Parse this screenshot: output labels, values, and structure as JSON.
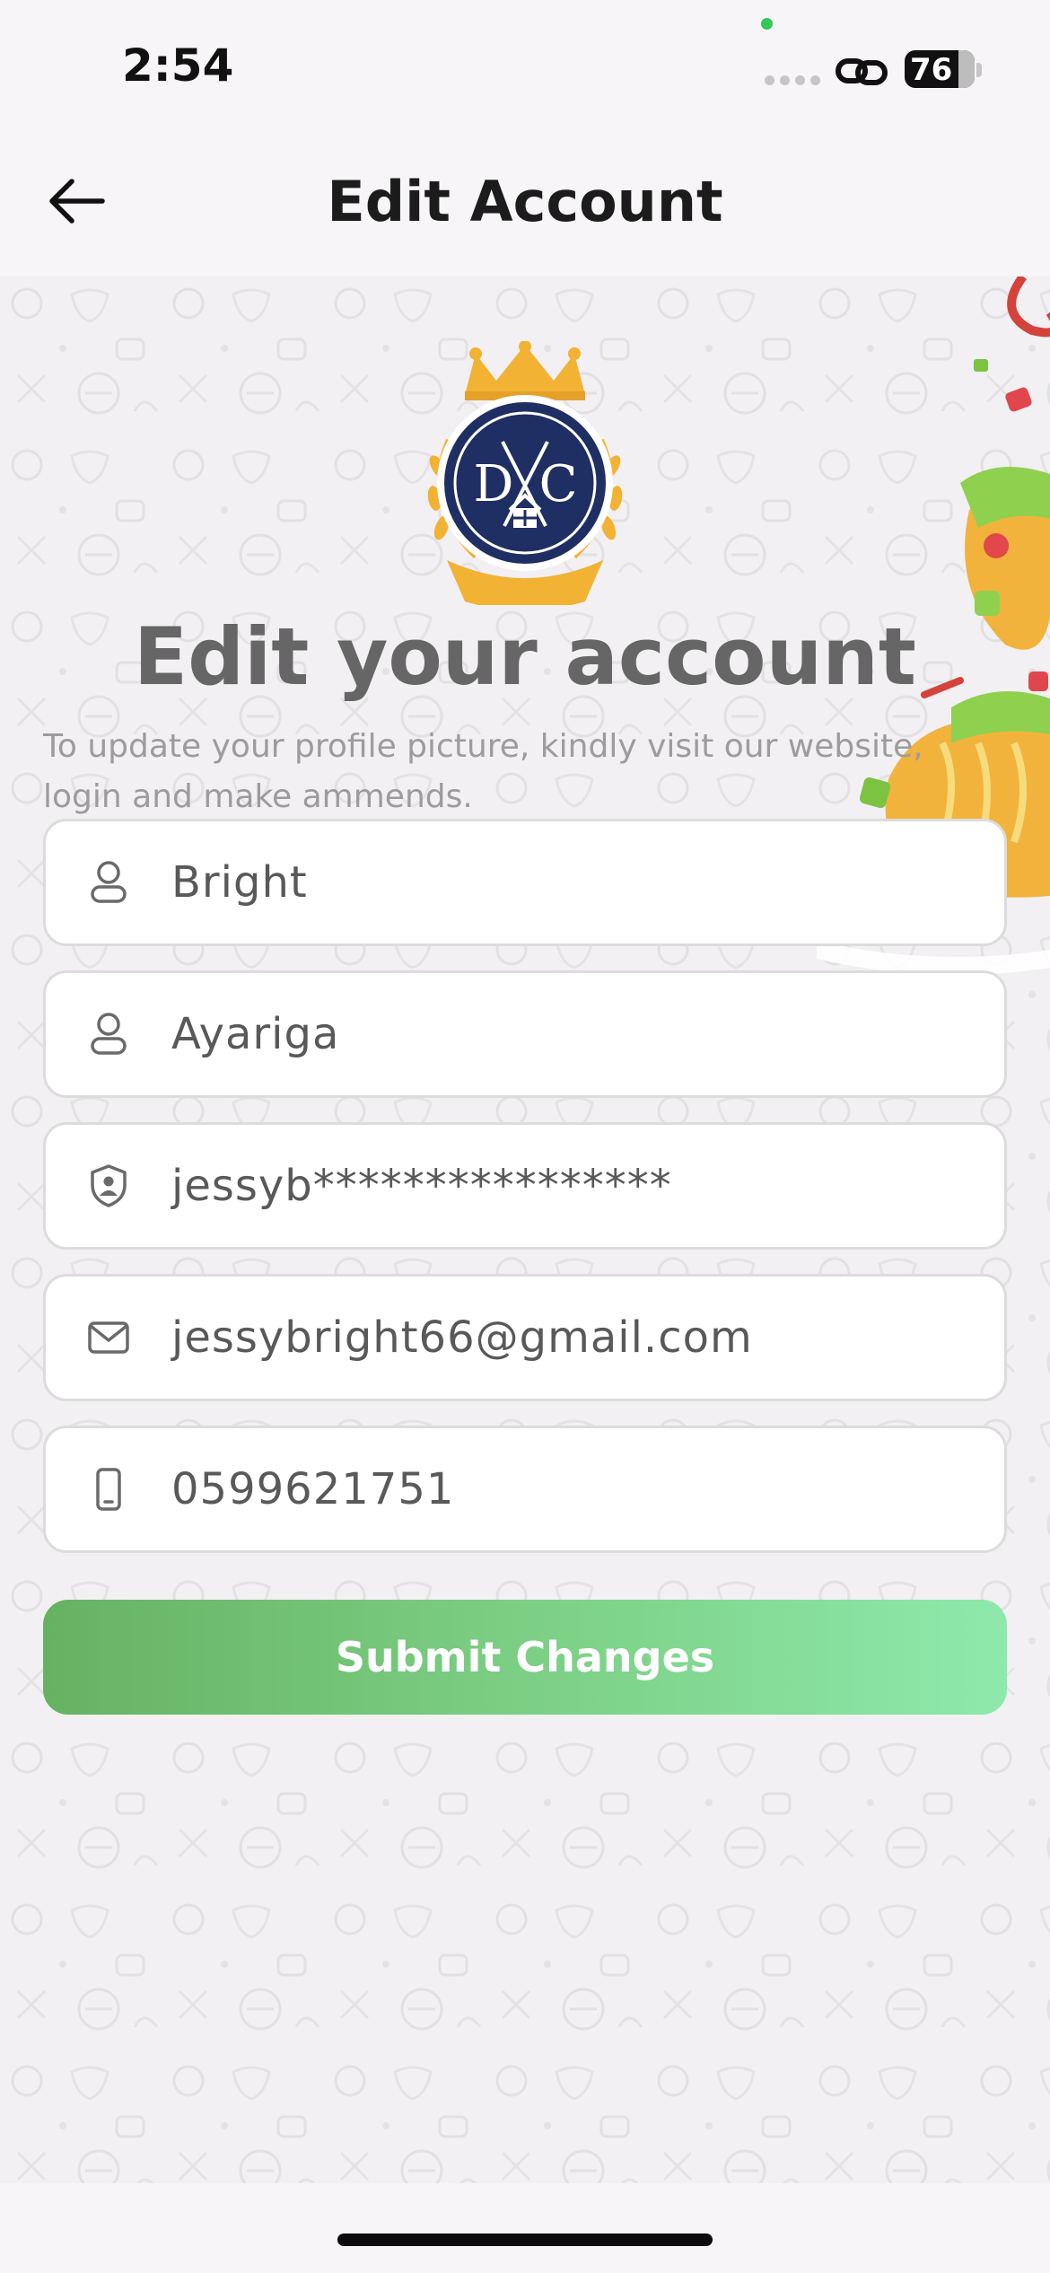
{
  "status_bar": {
    "time": "2:54",
    "battery_level": "76",
    "icons": [
      "signal-dots-icon",
      "link-icon",
      "battery-icon"
    ]
  },
  "nav": {
    "title": "Edit Account",
    "back_icon": "arrow-left-icon"
  },
  "main": {
    "logo_text": "DC",
    "heading": "Edit your account",
    "subtext": "To update your profile picture, kindly visit our website, login and make ammends.",
    "fields": [
      {
        "icon": "user-icon",
        "value": "Bright"
      },
      {
        "icon": "user-icon",
        "value": "Ayariga"
      },
      {
        "icon": "shield-icon",
        "value": "jessyb****************"
      },
      {
        "icon": "mail-icon",
        "value": "jessybright66@gmail.com"
      },
      {
        "icon": "phone-icon",
        "value": "0599621751"
      }
    ],
    "submit_label": "Submit Changes"
  },
  "colors": {
    "accent_start": "#66b263",
    "accent_end": "#8ee9ac",
    "logo_navy": "#1f2f63",
    "logo_gold": "#f2b233"
  }
}
